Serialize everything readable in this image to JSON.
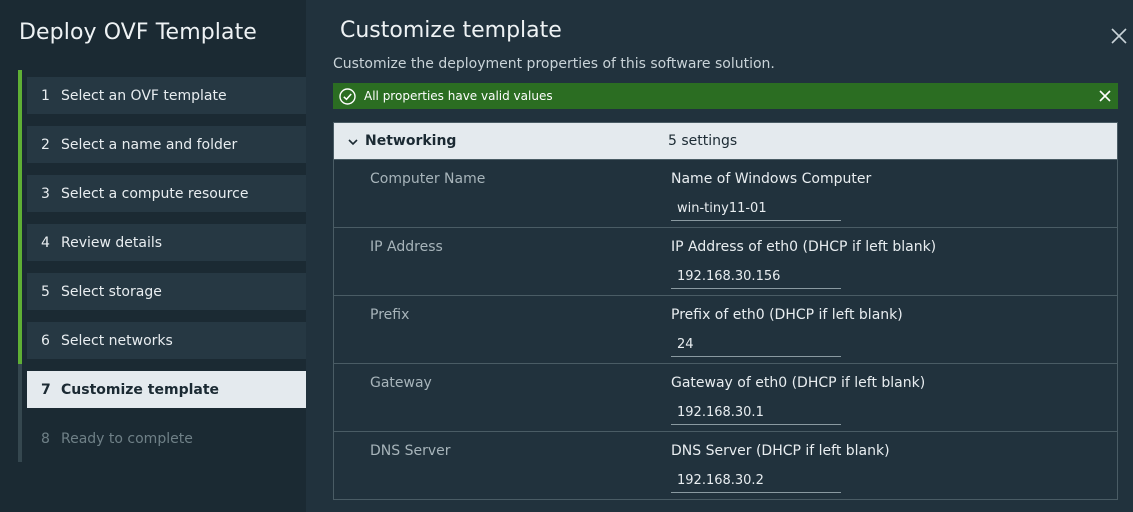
{
  "sidebar": {
    "title": "Deploy OVF Template",
    "steps": [
      {
        "num": "1",
        "label": "Select an OVF template"
      },
      {
        "num": "2",
        "label": "Select a name and folder"
      },
      {
        "num": "3",
        "label": "Select a compute resource"
      },
      {
        "num": "4",
        "label": "Review details"
      },
      {
        "num": "5",
        "label": "Select storage"
      },
      {
        "num": "6",
        "label": "Select networks"
      },
      {
        "num": "7",
        "label": "Customize template"
      },
      {
        "num": "8",
        "label": "Ready to complete"
      }
    ]
  },
  "main": {
    "title": "Customize template",
    "subtitle": "Customize the deployment properties of this software solution.",
    "banner": {
      "message": "All properties have valid values",
      "color": "#2b6d22"
    },
    "group": {
      "name": "Networking",
      "count": "5 settings",
      "rows": [
        {
          "label": "Computer Name",
          "description": "Name of Windows Computer",
          "value": "win-tiny11-01"
        },
        {
          "label": "IP Address",
          "description": "IP Address of eth0 (DHCP if left blank)",
          "value": "192.168.30.156"
        },
        {
          "label": "Prefix",
          "description": "Prefix of eth0 (DHCP if left blank)",
          "value": "24"
        },
        {
          "label": "Gateway",
          "description": "Gateway of eth0 (DHCP if left blank)",
          "value": "192.168.30.1"
        },
        {
          "label": "DNS Server",
          "description": "DNS Server (DHCP if left blank)",
          "value": "192.168.30.2"
        }
      ]
    }
  },
  "colors": {
    "accent_complete": "#5faf35",
    "sidebar_bg": "#1b2a33",
    "main_bg": "#21323d"
  },
  "icons": {
    "close": "close-icon",
    "ok": "check-circle-icon",
    "chevron": "chevron-down-icon"
  }
}
